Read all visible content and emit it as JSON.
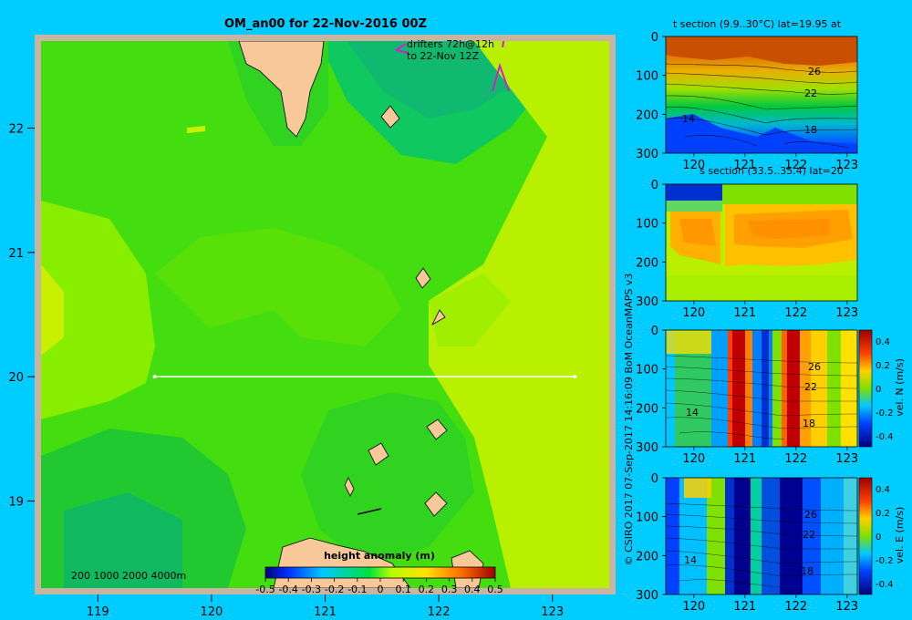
{
  "main_map": {
    "title": "OM_an00 for 22-Nov-2016 00Z",
    "lon_ticks": [
      "119",
      "120",
      "121",
      "122",
      "123"
    ],
    "lat_ticks": [
      "22",
      "21",
      "20",
      "19"
    ],
    "drifters_line1": "drifters 72h@12h",
    "drifters_line2": "to 22-Nov 12Z",
    "depth_scale": "200  1000  2000  4000m",
    "colorbar_title": "height anomaly (m)",
    "colorbar_ticks": [
      "-0.5",
      "-0.4",
      "-0.3",
      "-0.2",
      "-0.1",
      "0",
      "0.1",
      "0.2",
      "0.3",
      "0.4",
      "0.5"
    ],
    "section_line": {
      "lat": 20,
      "lon_start": 119.5,
      "lon_end": 123.2
    }
  },
  "panels": {
    "t_title": "t section (9.9..30°C) lat=19.95 at",
    "s_title": "s section (33.5..35.4) lat=20",
    "depth_ticks": [
      "0",
      "100",
      "200",
      "300"
    ],
    "lon_ticks": [
      "120",
      "121",
      "122",
      "123"
    ],
    "contour_labels_t": [
      "26",
      "22",
      "14",
      "18"
    ],
    "contour_labels_v": [
      "26",
      "22",
      "14",
      "18"
    ],
    "vn_label": "vel. N (m/s)",
    "ve_label": "vel. E (m/s)",
    "vel_ticks": [
      "0.4",
      "0.2",
      "0",
      "-0.2",
      "-0.4"
    ]
  },
  "credit": "© CSIRO 2017   07-Sep-2017 14:16:09 BoM OceanMAPS v3",
  "colors": {
    "background": "#00ccff",
    "frame": "#c8b4a0",
    "land": "#f8c898"
  },
  "chart_data": [
    {
      "type": "heatmap",
      "title": "OM_an00 for 22-Nov-2016 00Z",
      "x_ticks": [
        119,
        120,
        121,
        122,
        123
      ],
      "y_ticks": [
        22,
        21,
        20,
        19
      ],
      "xlim": [
        118.5,
        123.5
      ],
      "ylim": [
        18.3,
        22.7
      ],
      "colorbar": {
        "label": "height anomaly (m)",
        "range": [
          -0.5,
          0.5
        ],
        "step": 0.1
      }
    },
    {
      "type": "heatmap",
      "title": "t section (9.9..30°C) lat=19.95 at",
      "x_ticks": [
        120,
        121,
        122,
        123
      ],
      "y_ticks": [
        0,
        100,
        200,
        300
      ],
      "contour_labels": [
        26,
        22,
        14,
        18
      ]
    },
    {
      "type": "heatmap",
      "title": "s section (33.5..35.4) lat=20",
      "x_ticks": [
        120,
        121,
        122,
        123
      ],
      "y_ticks": [
        0,
        100,
        200,
        300
      ]
    },
    {
      "type": "heatmap",
      "x_ticks": [
        120,
        121,
        122,
        123
      ],
      "y_ticks": [
        0,
        100,
        200,
        300
      ],
      "colorbar": {
        "label": "vel. N (m/s)",
        "range": [
          -0.4,
          0.4
        ]
      }
    },
    {
      "type": "heatmap",
      "x_ticks": [
        120,
        121,
        122,
        123
      ],
      "y_ticks": [
        0,
        100,
        200,
        300
      ],
      "colorbar": {
        "label": "vel. E (m/s)",
        "range": [
          -0.4,
          0.4
        ]
      }
    }
  ]
}
